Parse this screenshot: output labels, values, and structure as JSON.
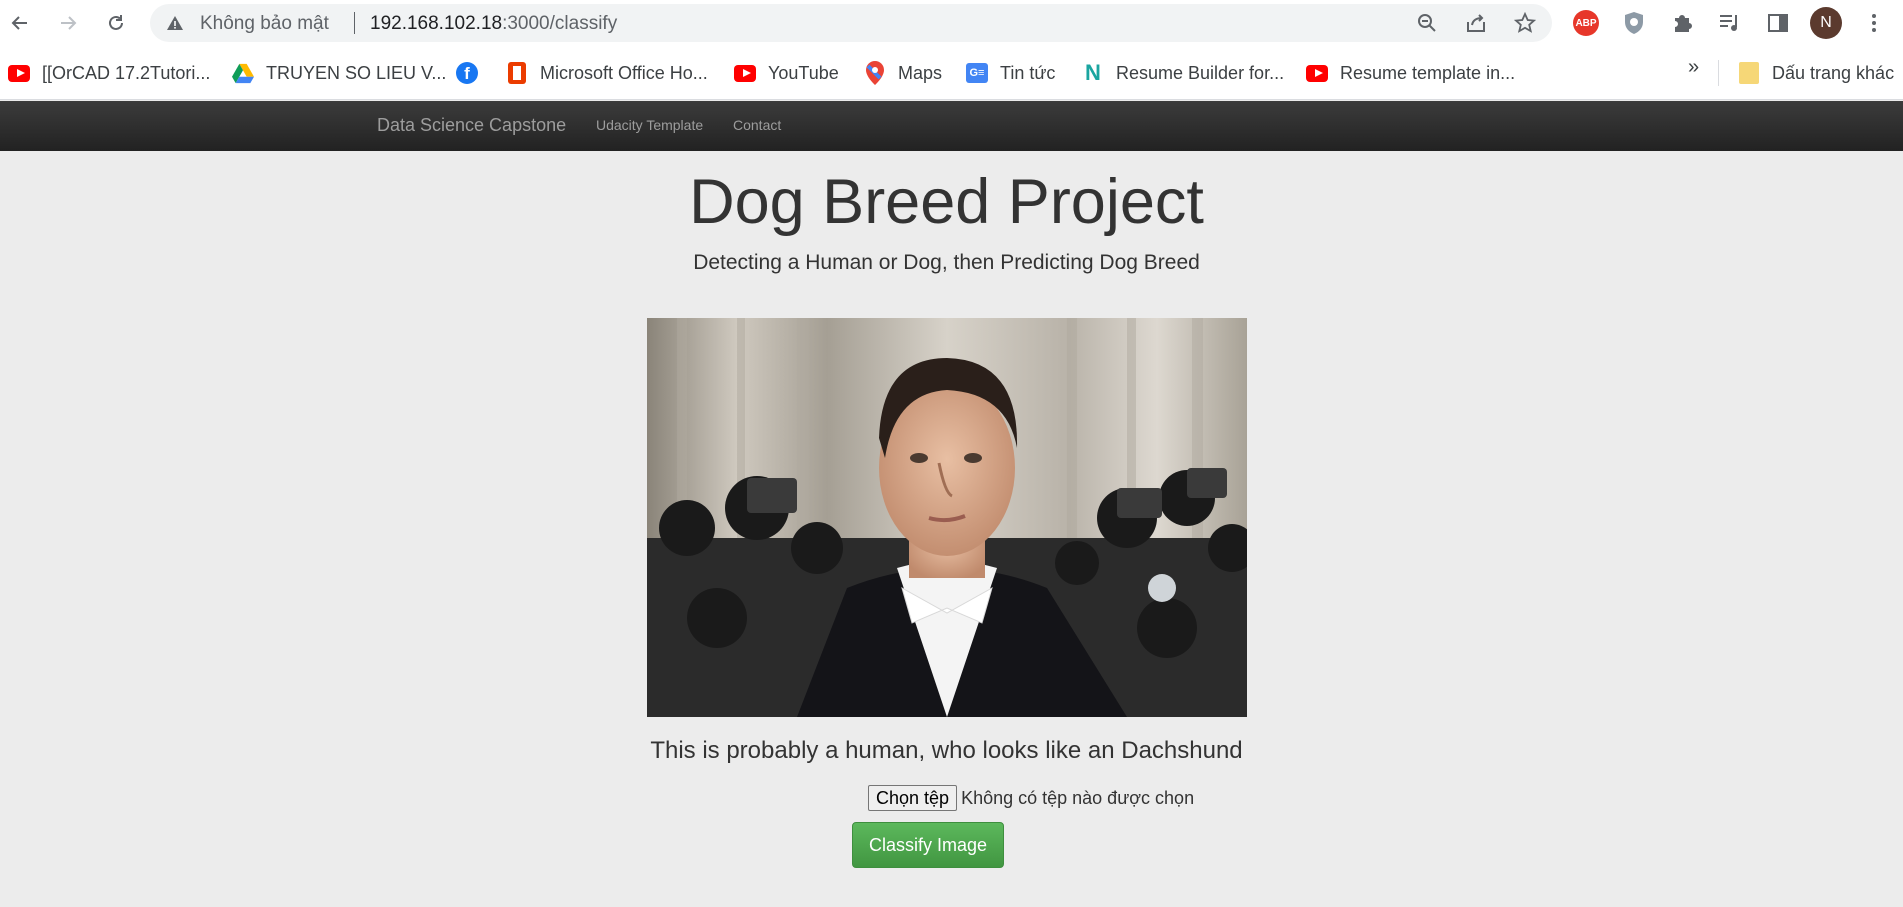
{
  "browser": {
    "security_label": "Không bảo mật",
    "url_host": "192.168.102.18",
    "url_path": ":3000/classify",
    "profile_initial": "N",
    "adblock_label": "ABP"
  },
  "bookmarks": [
    {
      "label": "[[OrCAD 17.2Tutori...",
      "icon": "youtube-icon"
    },
    {
      "label": "TRUYEN SO LIEU V...",
      "icon": "google-drive-icon"
    },
    {
      "label": "",
      "icon": "facebook-icon"
    },
    {
      "label": "Microsoft Office Ho...",
      "icon": "office-icon"
    },
    {
      "label": "YouTube",
      "icon": "youtube-icon"
    },
    {
      "label": "Maps",
      "icon": "maps-icon"
    },
    {
      "label": "Tin tức",
      "icon": "google-news-icon"
    },
    {
      "label": "Resume Builder for...",
      "icon": "resume-builder-icon"
    },
    {
      "label": "Resume template in...",
      "icon": "youtube-icon"
    }
  ],
  "bookmarks_more": "»",
  "other_bookmarks": "Dấu trang khác",
  "navbar": {
    "brand": "Data Science Capstone",
    "links": [
      "Udacity Template",
      "Contact"
    ]
  },
  "main": {
    "title": "Dog Breed Project",
    "subtitle": "Detecting a Human or Dog, then Predicting Dog Breed",
    "result": "This is probably a human, who looks like an Dachshund",
    "file_button": "Chọn tệp",
    "file_status": "Không có tệp nào được chọn",
    "classify_button": "Classify Image"
  },
  "colors": {
    "navbar_bg": "#222222",
    "classify_green": "#4cae4c",
    "page_bg": "#ececec"
  }
}
